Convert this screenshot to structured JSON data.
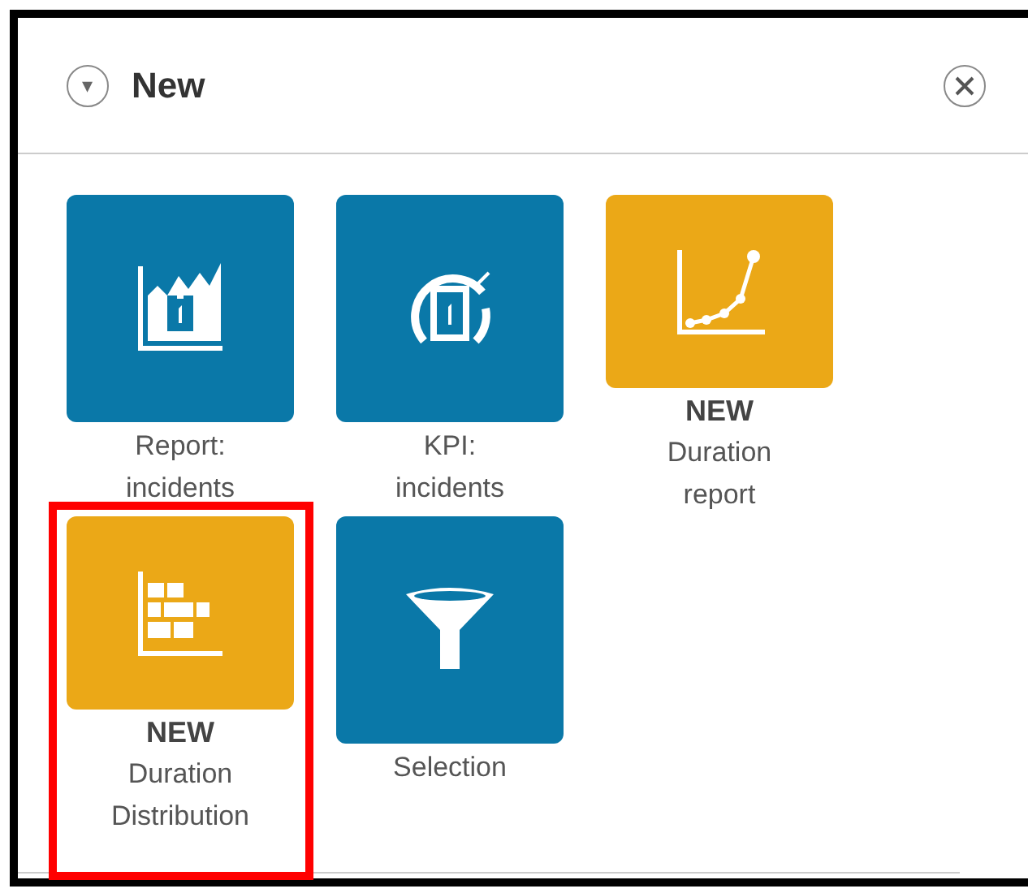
{
  "header": {
    "title": "New",
    "collapse_icon": "▾"
  },
  "tiles": [
    {
      "kind": "report",
      "color": "#0a78a8",
      "label": "Report:\nincidents",
      "highlighted": false
    },
    {
      "kind": "kpi",
      "color": "#0a78a8",
      "label": "KPI:\nincidents",
      "highlighted": false
    },
    {
      "kind": "duration",
      "color": "#eba817",
      "badge": "NEW",
      "label": "Duration\nreport",
      "highlighted": false
    },
    {
      "kind": "distribution",
      "color": "#eba817",
      "badge": "NEW",
      "label": "Duration\nDistribution",
      "highlighted": true
    },
    {
      "kind": "filter",
      "color": "#0a78a8",
      "label": "Selection",
      "highlighted": false
    }
  ]
}
